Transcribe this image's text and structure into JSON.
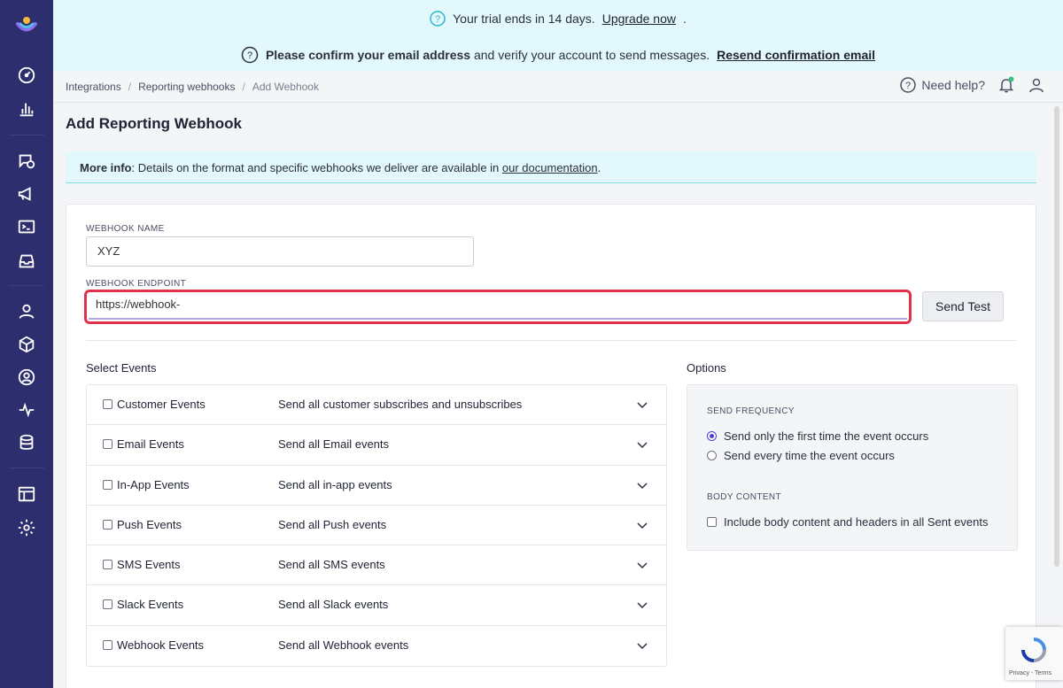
{
  "sidebar": {
    "icons": [
      "dashboard-icon",
      "analytics-icon",
      "messages-icon",
      "broadcast-icon",
      "terminal-icon",
      "inbox-icon",
      "people-icon",
      "objects-icon",
      "segments-icon",
      "activity-icon",
      "data-icon",
      "layout-icon",
      "settings-icon"
    ]
  },
  "banner": {
    "trial_text": "Your trial ends in 14 days.",
    "upgrade_link": "Upgrade now",
    "confirm_bold": "Please confirm your email address",
    "confirm_text": "and verify your account to send messages.",
    "resend_link": "Resend confirmation email"
  },
  "breadcrumb": [
    "Integrations",
    "Reporting webhooks",
    "Add Webhook"
  ],
  "topbar": {
    "help_label": "Need help?"
  },
  "page": {
    "title": "Add Reporting Webhook",
    "info_bold": "More info",
    "info_text": ": Details on the format and specific webhooks we deliver are available in",
    "info_link": "our documentation"
  },
  "form": {
    "name_label": "WEBHOOK NAME",
    "name_value": "XYZ",
    "endpoint_label": "WEBHOOK ENDPOINT",
    "endpoint_value": "https://webhook-",
    "send_test": "Send Test"
  },
  "events": {
    "title": "Select Events",
    "rows": [
      {
        "name": "Customer Events",
        "desc": "Send all customer subscribes and unsubscribes"
      },
      {
        "name": "Email Events",
        "desc": "Send all Email events"
      },
      {
        "name": "In-App Events",
        "desc": "Send all in-app events"
      },
      {
        "name": "Push Events",
        "desc": "Send all Push events"
      },
      {
        "name": "SMS Events",
        "desc": "Send all SMS events"
      },
      {
        "name": "Slack Events",
        "desc": "Send all Slack events"
      },
      {
        "name": "Webhook Events",
        "desc": "Send all Webhook events"
      }
    ]
  },
  "options": {
    "title": "Options",
    "frequency_label": "SEND FREQUENCY",
    "freq_first": "Send only the first time the event occurs",
    "freq_every": "Send every time the event occurs",
    "selected_frequency": "first",
    "body_label": "BODY CONTENT",
    "body_option": "Include body content and headers in all Sent events"
  },
  "recaptcha": {
    "text": "Privacy - Terms"
  },
  "colors": {
    "sidebar": "#2c2e6e",
    "accent": "#4b3fd1",
    "highlight": "#e0314b",
    "banner": "#e3f8fb"
  }
}
